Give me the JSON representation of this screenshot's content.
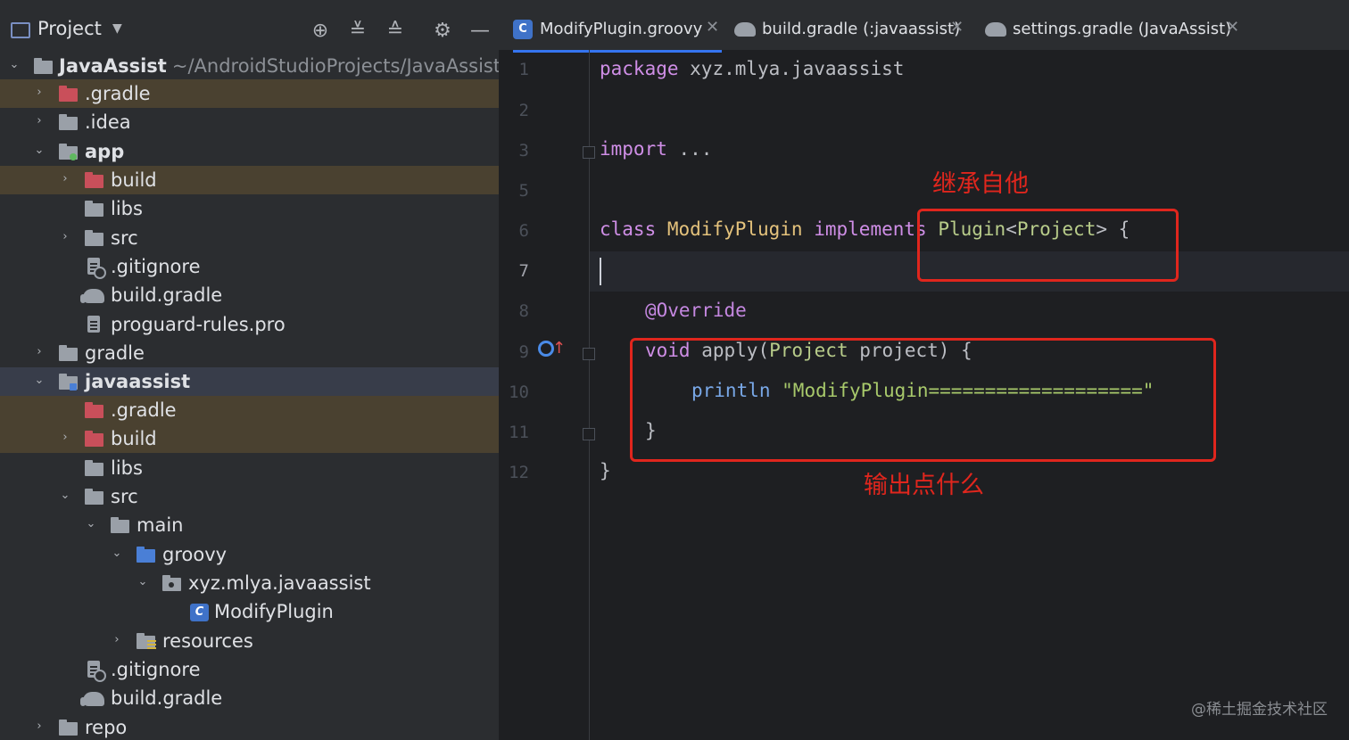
{
  "panel": {
    "title": "Project",
    "icons": [
      "locate-icon",
      "expand-all-icon",
      "collapse-all-icon",
      "gear-icon",
      "minimize-icon"
    ]
  },
  "tree": [
    {
      "label": "JavaAssist",
      "path": "~/AndroidStudioProjects/JavaAssist",
      "bold": true,
      "icon": "module-folder-icon",
      "expanded": true
    },
    {
      "label": ".gradle",
      "icon": "excluded-folder-icon",
      "collapsed": true
    },
    {
      "label": ".idea",
      "icon": "folder-icon",
      "collapsed": true
    },
    {
      "label": "app",
      "icon": "module-folder-icon",
      "expanded": true,
      "bold": true
    },
    {
      "label": "build",
      "icon": "excluded-folder-icon",
      "collapsed": true
    },
    {
      "label": "libs",
      "icon": "folder-icon"
    },
    {
      "label": "src",
      "icon": "folder-icon",
      "collapsed": true
    },
    {
      "label": ".gitignore",
      "icon": "gitignore-file-icon"
    },
    {
      "label": "build.gradle",
      "icon": "gradle-file-icon"
    },
    {
      "label": "proguard-rules.pro",
      "icon": "text-file-icon"
    },
    {
      "label": "gradle",
      "icon": "folder-icon",
      "collapsed": true
    },
    {
      "label": "javaassist",
      "icon": "module-folder-icon",
      "expanded": true,
      "bold": true
    },
    {
      "label": ".gradle",
      "icon": "excluded-folder-icon"
    },
    {
      "label": "build",
      "icon": "excluded-folder-icon",
      "collapsed": true
    },
    {
      "label": "libs",
      "icon": "folder-icon"
    },
    {
      "label": "src",
      "icon": "folder-icon",
      "expanded": true
    },
    {
      "label": "main",
      "icon": "folder-icon",
      "expanded": true
    },
    {
      "label": "groovy",
      "icon": "source-folder-icon",
      "expanded": true
    },
    {
      "label": "xyz.mlya.javaassist",
      "icon": "package-icon",
      "expanded": true
    },
    {
      "label": "ModifyPlugin",
      "icon": "groovy-class-icon"
    },
    {
      "label": "resources",
      "icon": "resources-folder-icon",
      "collapsed": true
    },
    {
      "label": ".gitignore",
      "icon": "gitignore-file-icon"
    },
    {
      "label": "build.gradle",
      "icon": "gradle-file-icon"
    },
    {
      "label": "repo",
      "icon": "folder-icon",
      "collapsed": true
    }
  ],
  "tabs": [
    {
      "label": "ModifyPlugin.groovy",
      "icon": "groovy-class-icon",
      "active": true
    },
    {
      "label": "build.gradle (:javaassist)",
      "icon": "gradle-file-icon"
    },
    {
      "label": "settings.gradle (JavaAssist)",
      "icon": "gradle-file-icon"
    }
  ],
  "code": {
    "line_numbers": [
      "1",
      "2",
      "3",
      "5",
      "6",
      "7",
      "8",
      "9",
      "10",
      "11",
      "12"
    ],
    "current_line": "7",
    "l1_kw": "package",
    "l1_rest": " xyz.mlya.javaassist",
    "l3_kw": "import",
    "l3_rest": " ...",
    "l6_kw1": "class",
    "l6_cls": " ModifyPlugin ",
    "l6_kw2": "implements",
    "l6_plugin": " Plugin",
    "l6_lt": "<",
    "l6_proj": "Project",
    "l6_rest": "> {",
    "l8_ann": "@Override",
    "l9_void": "void",
    "l9_fn": " apply",
    "l9_open": "(",
    "l9_type": "Project",
    "l9_rest": " project) {",
    "l10_fn": "println",
    "l10_str": " \"ModifyPlugin===================\"",
    "l11": "}",
    "l12": "}"
  },
  "annotations": {
    "inherit_label": "继承自他",
    "output_label": "输出点什么",
    "color": "#e0261d"
  },
  "watermark": "@稀土掘金技术社区"
}
